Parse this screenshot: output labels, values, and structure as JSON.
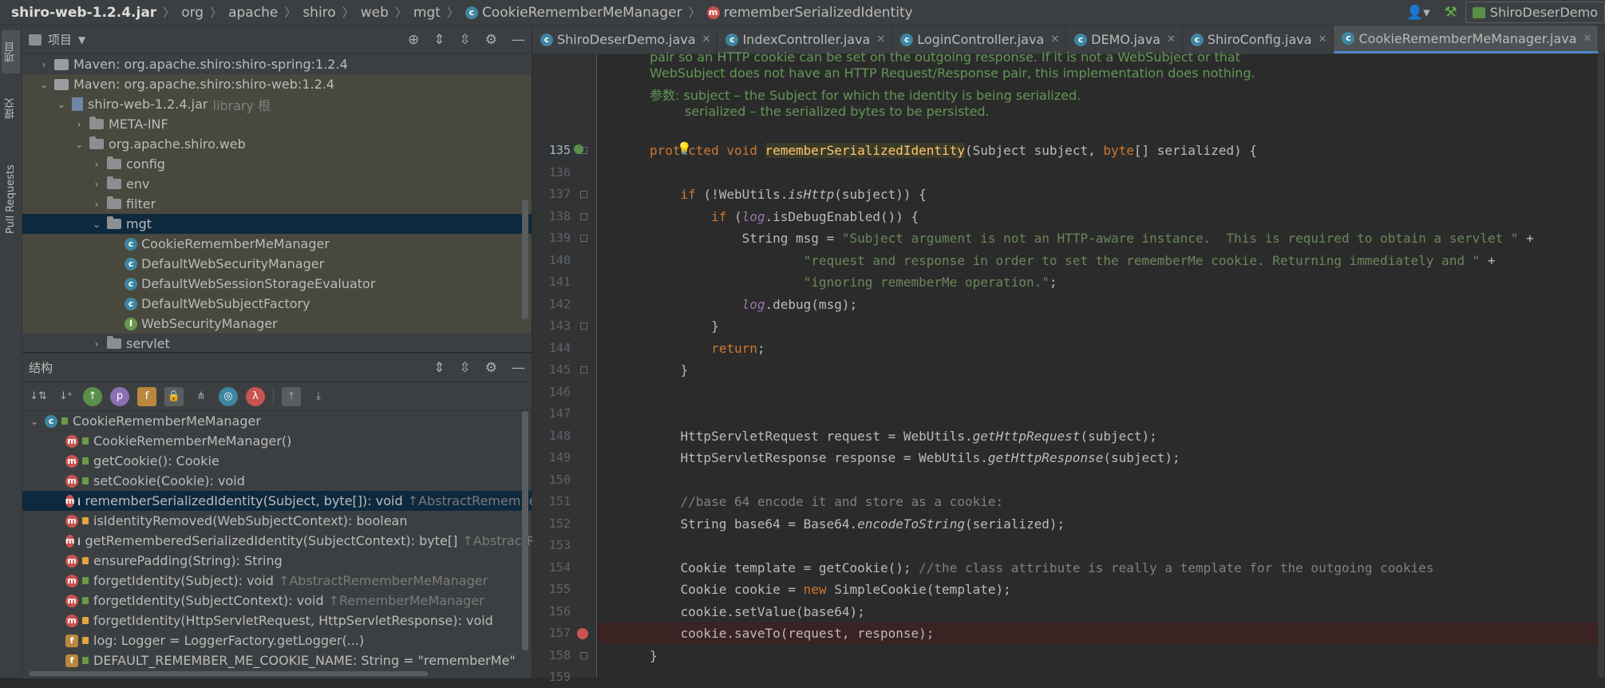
{
  "navbar": {
    "crumbs": [
      "shiro-web-1.2.4.jar",
      "org",
      "apache",
      "shiro",
      "web",
      "mgt",
      "CookieRememberMeManager",
      "rememberSerializedIdentity"
    ],
    "run_config": "ShiroDeserDemo"
  },
  "sidebar_tabs": [
    "项目",
    "提交",
    "Pull Requests"
  ],
  "project": {
    "title": "项目",
    "tree": [
      {
        "label": "Maven: org.apache.shiro:shiro-spring:1.2.4",
        "indent": 1,
        "kind": "maven",
        "arrow": "›"
      },
      {
        "label": "Maven: org.apache.shiro:shiro-web:1.2.4",
        "indent": 1,
        "kind": "maven",
        "arrow": "⌄"
      },
      {
        "label": "shiro-web-1.2.4.jar",
        "note": "library 根",
        "indent": 2,
        "kind": "jar",
        "arrow": "⌄"
      },
      {
        "label": "META-INF",
        "indent": 3,
        "kind": "folder",
        "arrow": "›"
      },
      {
        "label": "org.apache.shiro.web",
        "indent": 3,
        "kind": "folder",
        "arrow": "⌄"
      },
      {
        "label": "config",
        "indent": 4,
        "kind": "folder",
        "arrow": "›"
      },
      {
        "label": "env",
        "indent": 4,
        "kind": "folder",
        "arrow": "›"
      },
      {
        "label": "filter",
        "indent": 4,
        "kind": "folder",
        "arrow": "›"
      },
      {
        "label": "mgt",
        "indent": 4,
        "kind": "folder",
        "arrow": "⌄",
        "selected": true
      },
      {
        "label": "CookieRememberMeManager",
        "indent": 5,
        "kind": "class"
      },
      {
        "label": "DefaultWebSecurityManager",
        "indent": 5,
        "kind": "class"
      },
      {
        "label": "DefaultWebSessionStorageEvaluator",
        "indent": 5,
        "kind": "class"
      },
      {
        "label": "DefaultWebSubjectFactory",
        "indent": 5,
        "kind": "class"
      },
      {
        "label": "WebSecurityManager",
        "indent": 5,
        "kind": "interface"
      },
      {
        "label": "servlet",
        "indent": 4,
        "kind": "folder",
        "arrow": "›"
      }
    ]
  },
  "structure": {
    "title": "结构",
    "root": "CookieRememberMeManager",
    "members": [
      {
        "label": "CookieRememberMeManager()",
        "vis": "unlock",
        "kind": "m"
      },
      {
        "label": "getCookie(): Cookie",
        "vis": "unlock",
        "kind": "m"
      },
      {
        "label": "setCookie(Cookie): void",
        "vis": "unlock",
        "kind": "m"
      },
      {
        "label": "rememberSerializedIdentity(Subject, byte[]): void",
        "up": "↑AbstractRememberMeManager",
        "vis": "key",
        "kind": "m",
        "selected": true
      },
      {
        "label": "isIdentityRemoved(WebSubjectContext): boolean",
        "vis": "lock",
        "kind": "m"
      },
      {
        "label": "getRememberedSerializedIdentity(SubjectContext): byte[]",
        "up": "↑AbstractRememberMeManager",
        "vis": "key",
        "kind": "m"
      },
      {
        "label": "ensurePadding(String): String",
        "vis": "lock",
        "kind": "m"
      },
      {
        "label": "forgetIdentity(Subject): void",
        "up": "↑AbstractRememberMeManager",
        "vis": "unlock",
        "kind": "m"
      },
      {
        "label": "forgetIdentity(SubjectContext): void",
        "up": "↑RememberMeManager",
        "vis": "unlock",
        "kind": "m"
      },
      {
        "label": "forgetIdentity(HttpServletRequest, HttpServletResponse): void",
        "vis": "lock",
        "kind": "m"
      },
      {
        "label": "log: Logger = LoggerFactory.getLogger(...)",
        "vis": "lock",
        "kind": "f"
      },
      {
        "label": "DEFAULT_REMEMBER_ME_COOKIE_NAME: String = \"rememberMe\"",
        "vis": "unlock",
        "kind": "f"
      }
    ]
  },
  "tabs": [
    {
      "label": "ShiroDeserDemo.java"
    },
    {
      "label": "IndexController.java"
    },
    {
      "label": "LoginController.java"
    },
    {
      "label": "DEMO.java"
    },
    {
      "label": "ShiroConfig.java"
    },
    {
      "label": "CookieRememberMeManager.java",
      "active": true
    }
  ],
  "doc": {
    "line0": "pair so an HTTP cookie can be set on the outgoing response. If it is not a WebSubject or that",
    "line1": "WebSubject does not have an HTTP Request/Response pair, this implementation does nothing.",
    "line2": "参数: subject – the Subject for which the identity is being serialized.",
    "line3": "serialized – the serialized bytes to be persisted."
  },
  "code_lines": [
    {
      "n": "135",
      "html": "<span class=\"k\">protected void </span><span class=\"fn\" style=\"background:#3b3b2a\">rememberSerializedIdentity</span>(Subject subject, <span class=\"k\">byte</span>[] serialized) {"
    },
    {
      "n": "136",
      "html": ""
    },
    {
      "n": "137",
      "html": "    <span class=\"k\">if </span>(!WebUtils.<span class=\"i\">isHttp</span>(subject)) {"
    },
    {
      "n": "138",
      "html": "        <span class=\"k\">if </span>(<span class=\"f i\">log</span>.isDebugEnabled()) {"
    },
    {
      "n": "139",
      "html": "            String msg = <span class=\"s\">\"Subject argument is not an HTTP-aware instance.  This is required to obtain a servlet \"</span> +"
    },
    {
      "n": "140",
      "html": "                    <span class=\"s\">\"request and response in order to set the rememberMe cookie. Returning immediately and \"</span> +"
    },
    {
      "n": "141",
      "html": "                    <span class=\"s\">\"ignoring rememberMe operation.\"</span>;"
    },
    {
      "n": "142",
      "html": "            <span class=\"f i\">log</span>.debug(msg);"
    },
    {
      "n": "143",
      "html": "        }"
    },
    {
      "n": "144",
      "html": "        <span class=\"k\">return</span>;"
    },
    {
      "n": "145",
      "html": "    }"
    },
    {
      "n": "146",
      "html": ""
    },
    {
      "n": "147",
      "html": ""
    },
    {
      "n": "148",
      "html": "    HttpServletRequest request = WebUtils.<span class=\"i\">getHttpRequest</span>(subject);"
    },
    {
      "n": "149",
      "html": "    HttpServletResponse response = WebUtils.<span class=\"i\">getHttpResponse</span>(subject);"
    },
    {
      "n": "150",
      "html": ""
    },
    {
      "n": "151",
      "html": "    <span class=\"c\">//base 64 encode it and store as a cookie:</span>"
    },
    {
      "n": "152",
      "html": "    String base64 = Base64.<span class=\"i\">encodeToString</span>(serialized);"
    },
    {
      "n": "153",
      "html": ""
    },
    {
      "n": "154",
      "html": "    Cookie template = getCookie(); <span class=\"c\">//the class attribute is really a template for the outgoing cookies</span>"
    },
    {
      "n": "155",
      "html": "    Cookie cookie = <span class=\"k\">new </span>SimpleCookie(template);"
    },
    {
      "n": "156",
      "html": "    cookie.setValue(base64);"
    },
    {
      "n": "157",
      "html": "    cookie.saveTo(request, response);",
      "bp": true
    },
    {
      "n": "158",
      "html": "}"
    },
    {
      "n": "159",
      "html": ""
    }
  ]
}
